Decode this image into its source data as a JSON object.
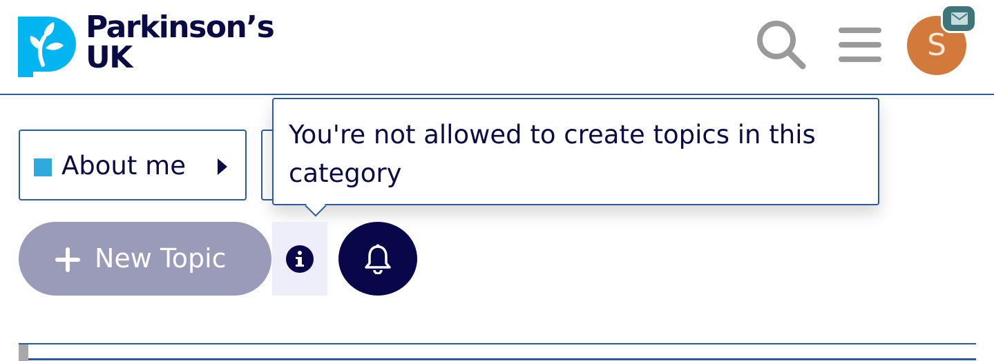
{
  "header": {
    "logo": {
      "line1": "Parkinson’s",
      "line2": "UK"
    },
    "icons": {
      "search": "search-icon",
      "menu": "hamburger-menu-icon",
      "mail": "envelope-icon"
    },
    "avatar": {
      "initial": "S",
      "color": "#d27a3c"
    },
    "badge_color": "#3d7579"
  },
  "category": {
    "label": "About me",
    "swatch_color": "#2eaadc"
  },
  "tooltip": {
    "text": "You're not allowed to create topics in this category"
  },
  "actions": {
    "new_topic_label": "New Topic",
    "new_topic_color": "#9a9bb8",
    "notification_color": "#07074a"
  },
  "colors": {
    "brand_navy": "#0a0a45",
    "accent_blue": "#2b5a9c",
    "logo_cyan": "#00b5f0"
  }
}
